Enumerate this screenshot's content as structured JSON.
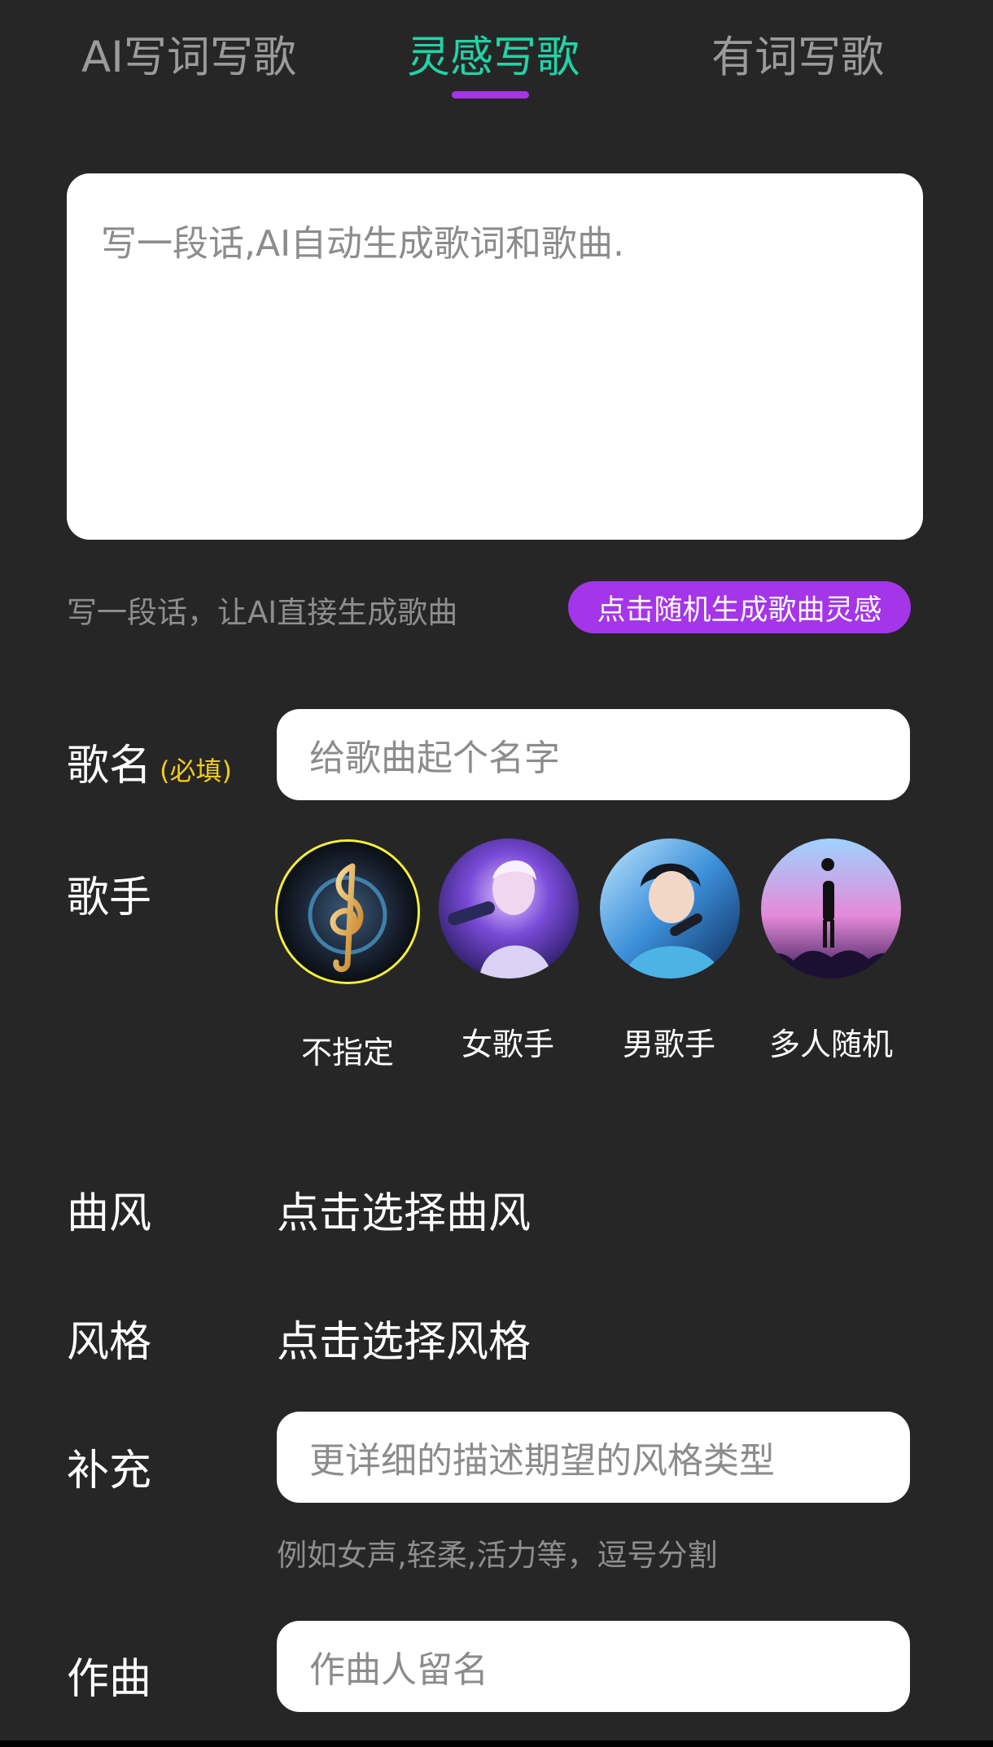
{
  "tabs": [
    {
      "label": "AI写词写歌",
      "active": false
    },
    {
      "label": "灵感写歌",
      "active": true
    },
    {
      "label": "有词写歌",
      "active": false
    }
  ],
  "inspiration": {
    "placeholder": "写一段话,AI自动生成歌词和歌曲.",
    "hint": "写一段话，让AI直接生成歌曲",
    "random_button": "点击随机生成歌曲灵感"
  },
  "song_name": {
    "label": "歌名",
    "required": "(必填)",
    "placeholder": "给歌曲起个名字"
  },
  "singer": {
    "label": "歌手",
    "options": [
      {
        "label": "不指定",
        "icon": "treble-clef-icon",
        "selected": true
      },
      {
        "label": "女歌手",
        "icon": "female-singer-avatar",
        "selected": false
      },
      {
        "label": "男歌手",
        "icon": "male-singer-avatar",
        "selected": false
      },
      {
        "label": "多人随机",
        "icon": "concert-crowd-avatar",
        "selected": false
      }
    ]
  },
  "genre": {
    "label": "曲风",
    "value": "点击选择曲风"
  },
  "style": {
    "label": "风格",
    "value": "点击选择风格"
  },
  "supplement": {
    "label": "补充",
    "placeholder": "更详细的描述期望的风格类型",
    "hint": "例如女声,轻柔,活力等，逗号分割"
  },
  "composer": {
    "label": "作曲",
    "placeholder": "作曲人留名"
  },
  "colors": {
    "background": "#262626",
    "accent_purple": "#a435e8",
    "active_tab": "#22d3a8",
    "required": "#f2cc17",
    "selected_ring": "#f5ef3b"
  }
}
